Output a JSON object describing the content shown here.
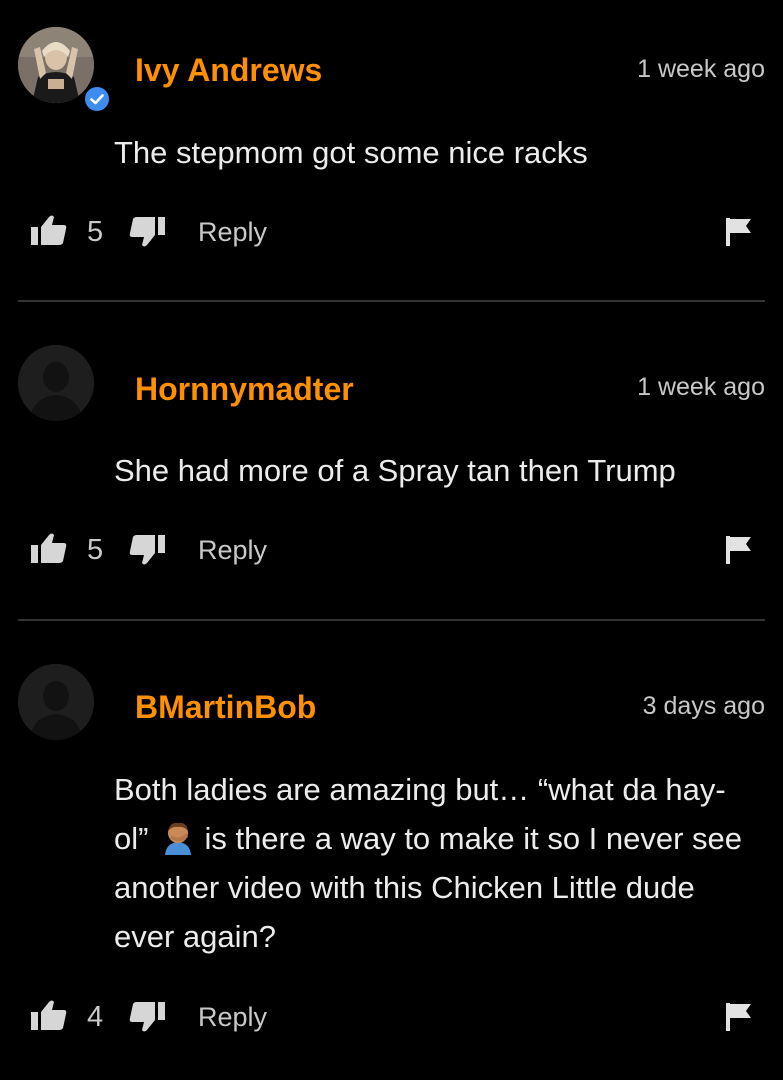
{
  "comments": [
    {
      "username": "Ivy Andrews",
      "timestamp": "1 week ago",
      "text": "The stepmom got some nice racks",
      "likes": "5",
      "reply_label": "Reply",
      "verified": true
    },
    {
      "username": "Hornnymadter",
      "timestamp": "1 week ago",
      "text": "She had more of a Spray tan then Trump",
      "likes": "5",
      "reply_label": "Reply",
      "verified": false
    },
    {
      "username": "BMartinBob",
      "timestamp": "3 days ago",
      "text_part1": "Both ladies are amazing but… “what da hay-ol”",
      "emoji": "man-facepalming-emoji",
      "text_part2": "is there a way to make it so I never see another video with this Chicken Little dude ever again?",
      "likes": "4",
      "reply_label": "Reply",
      "verified": false
    }
  ],
  "colors": {
    "background": "#000000",
    "username": "#ff9000",
    "verified_badge": "#3d8df0",
    "divider": "#333333",
    "text": "#ececec",
    "muted": "#c9c9c9"
  }
}
